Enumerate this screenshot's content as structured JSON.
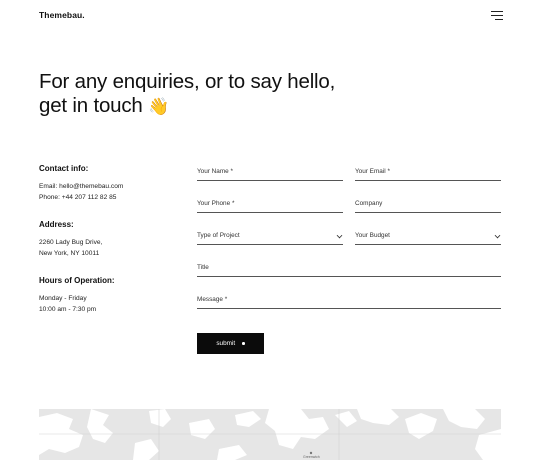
{
  "header": {
    "brand": "Themebau.",
    "menu_icon": "hamburger-menu-icon"
  },
  "hero": {
    "line1": "For any enquiries, or to say hello,",
    "line2": "get in touch",
    "emoji": "👋"
  },
  "contact": {
    "contact_heading": "Contact info:",
    "email_line": "Email: hello@themebau.com",
    "phone_line": "Phone: +44 207 112 82 85",
    "address_heading": "Address:",
    "address_line1": "2260  Lady Bug Drive,",
    "address_line2": "New York, NY 10011",
    "hours_heading": "Hours of Operation:",
    "hours_line1": "Monday - Friday",
    "hours_line2": "10:00 am - 7:30 pm"
  },
  "form": {
    "name_placeholder": "Your Name *",
    "email_placeholder": "Your Email *",
    "phone_placeholder": "Your Phone *",
    "company_placeholder": "Company",
    "project_type_label": "Type of Project",
    "budget_label": "Your Budget",
    "title_placeholder": "Title",
    "message_placeholder": "Message *",
    "submit_label": "submit"
  },
  "map": {
    "label": "Greenwich"
  }
}
